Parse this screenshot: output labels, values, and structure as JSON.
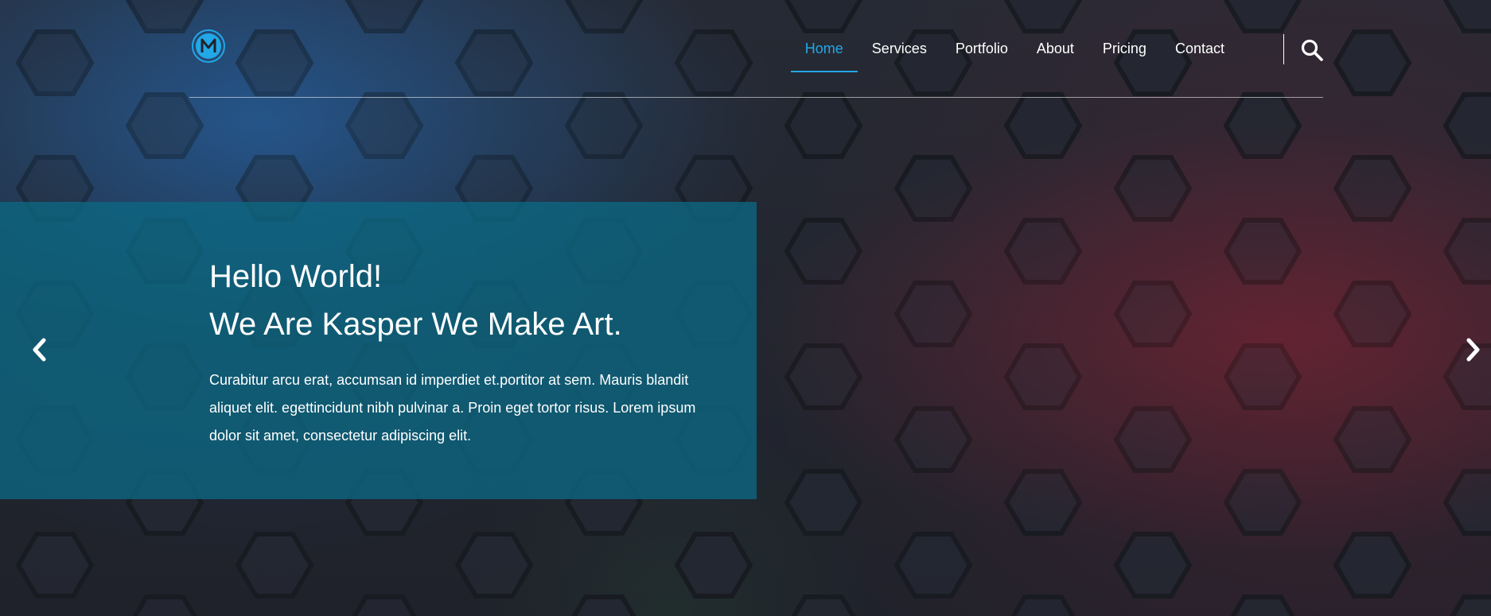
{
  "header": {
    "logo": {
      "letter": "M",
      "icon": "m-logo-icon",
      "color": "#22a7e7"
    },
    "nav": [
      {
        "label": "Home",
        "active": true
      },
      {
        "label": "Services",
        "active": false
      },
      {
        "label": "Portfolio",
        "active": false
      },
      {
        "label": "About",
        "active": false
      },
      {
        "label": "Pricing",
        "active": false
      },
      {
        "label": "Contact",
        "active": false
      }
    ],
    "search_icon": "search-icon"
  },
  "hero": {
    "title_line1": "Hello World!",
    "title_line2": "We Are Kasper We Make Art.",
    "description": "Curabitur arcu erat, accumsan id imperdiet et.portitor at sem. Mauris blandit aliquet elit. egettincidunt nibh pulvinar a. Proin eget tortor risus. Lorem ipsum dolor sit amet, consectetur adipiscing elit.",
    "prev_icon": "chevron-left-icon",
    "next_icon": "chevron-right-icon"
  },
  "colors": {
    "accent": "#22a7e7",
    "panel": "#0b6883",
    "background": "#1f222b",
    "text": "#ffffff"
  }
}
